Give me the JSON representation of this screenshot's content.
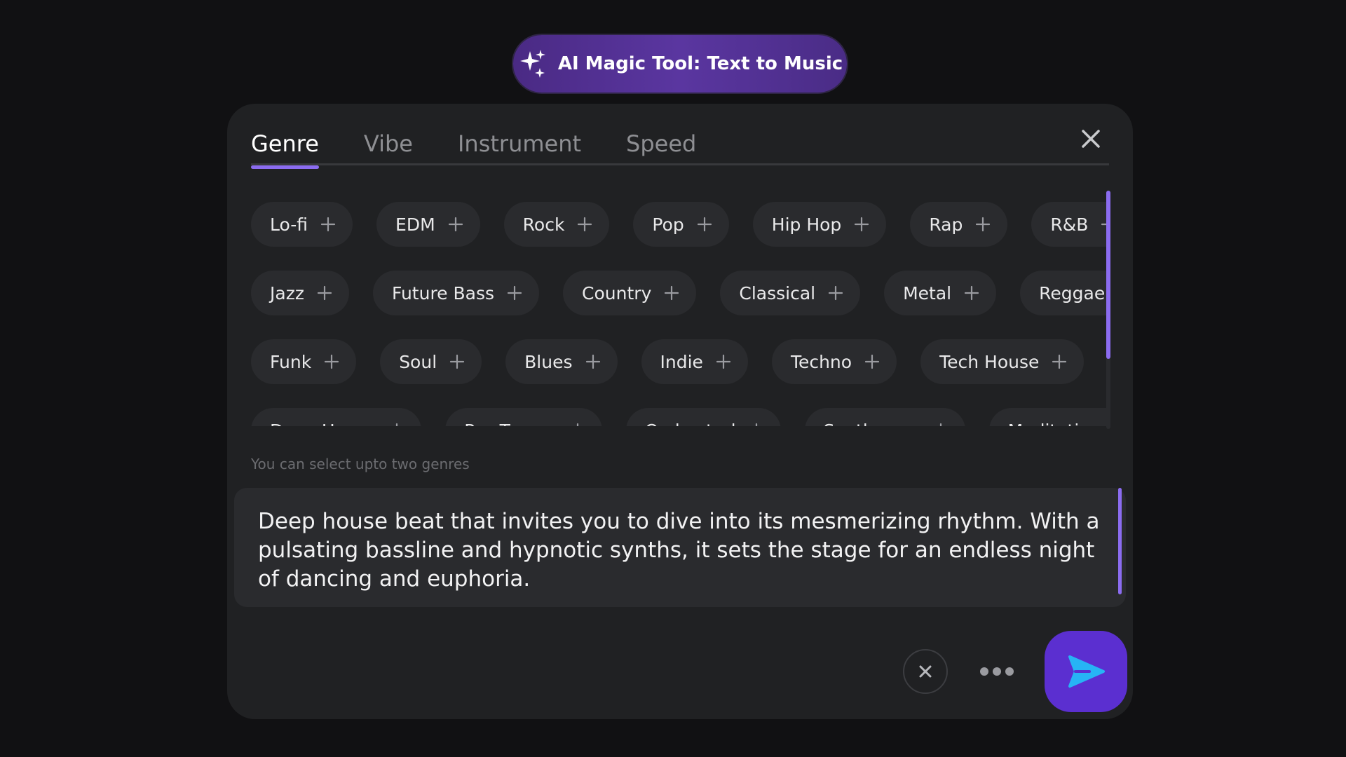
{
  "header": {
    "title": "AI Magic Tool: Text to Music",
    "icon": "sparkles-icon"
  },
  "tabs": [
    {
      "label": "Genre",
      "active": true
    },
    {
      "label": "Vibe",
      "active": false
    },
    {
      "label": "Instrument",
      "active": false
    },
    {
      "label": "Speed",
      "active": false
    }
  ],
  "genres": {
    "rows": [
      [
        "Lo-fi",
        "EDM",
        "Rock",
        "Pop",
        "Hip Hop",
        "Rap",
        "R&B"
      ],
      [
        "Jazz",
        "Future Bass",
        "Country",
        "Classical",
        "Metal",
        "Reggae"
      ],
      [
        "Funk",
        "Soul",
        "Blues",
        "Indie",
        "Techno",
        "Tech House"
      ],
      [
        "Deep House",
        "Psy Trance",
        "Orchestral",
        "Synthwave",
        "Meditation"
      ]
    ],
    "hint": "You can select upto two genres"
  },
  "prompt": {
    "text": "Deep house beat that invites you to dive into its mesmerizing rhythm. With a pulsating bassline and hypnotic synths, it sets the stage for an endless night of dancing and euphoria."
  },
  "colors": {
    "accent": "#8b6cf0",
    "send_button": "#5b2fd0",
    "send_arrow": "#27b4f5"
  }
}
